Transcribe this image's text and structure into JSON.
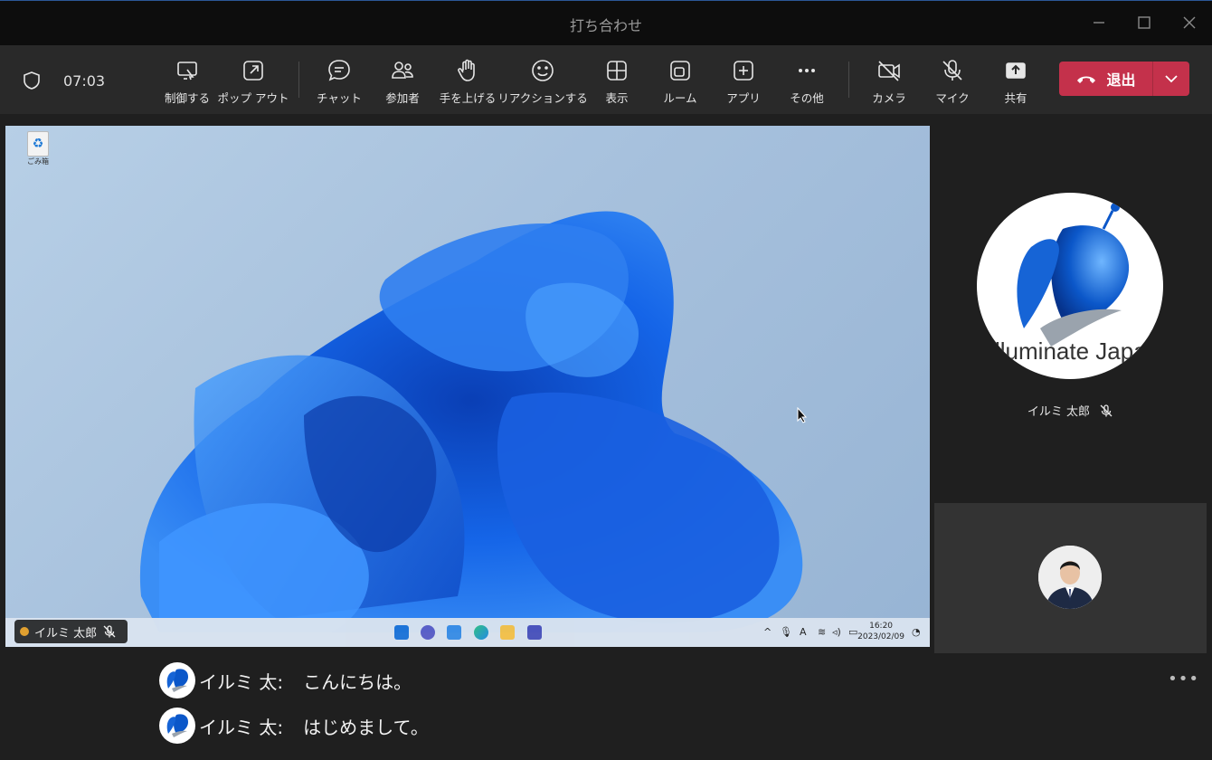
{
  "window": {
    "title": "打ち合わせ"
  },
  "toolbar": {
    "timer": "07:03",
    "buttons": [
      {
        "label": "制御する"
      },
      {
        "label": "ポップ アウト"
      },
      {
        "label": "チャット"
      },
      {
        "label": "参加者"
      },
      {
        "label": "手を上げる"
      },
      {
        "label": "リアクションする"
      },
      {
        "label": "表示"
      },
      {
        "label": "ルーム"
      },
      {
        "label": "アプリ"
      },
      {
        "label": "その他"
      },
      {
        "label": "カメラ"
      },
      {
        "label": "マイク"
      },
      {
        "label": "共有"
      }
    ],
    "leave_label": "退出",
    "leave_color": "#c4314b"
  },
  "shared_screen": {
    "presenter_name": "イルミ 太郎",
    "desktop_icon_label": "ごみ箱",
    "taskbar": {
      "time": "16:20",
      "date": "2023/02/09",
      "ime": "A"
    }
  },
  "participants": {
    "main": {
      "name": "イルミ 太郎",
      "avatar_text": "lluminate Japa",
      "muted": true
    }
  },
  "captions": [
    {
      "speaker": "イルミ 太:",
      "text": "こんにちは。"
    },
    {
      "speaker": "イルミ 太:",
      "text": "はじめまして。"
    }
  ]
}
